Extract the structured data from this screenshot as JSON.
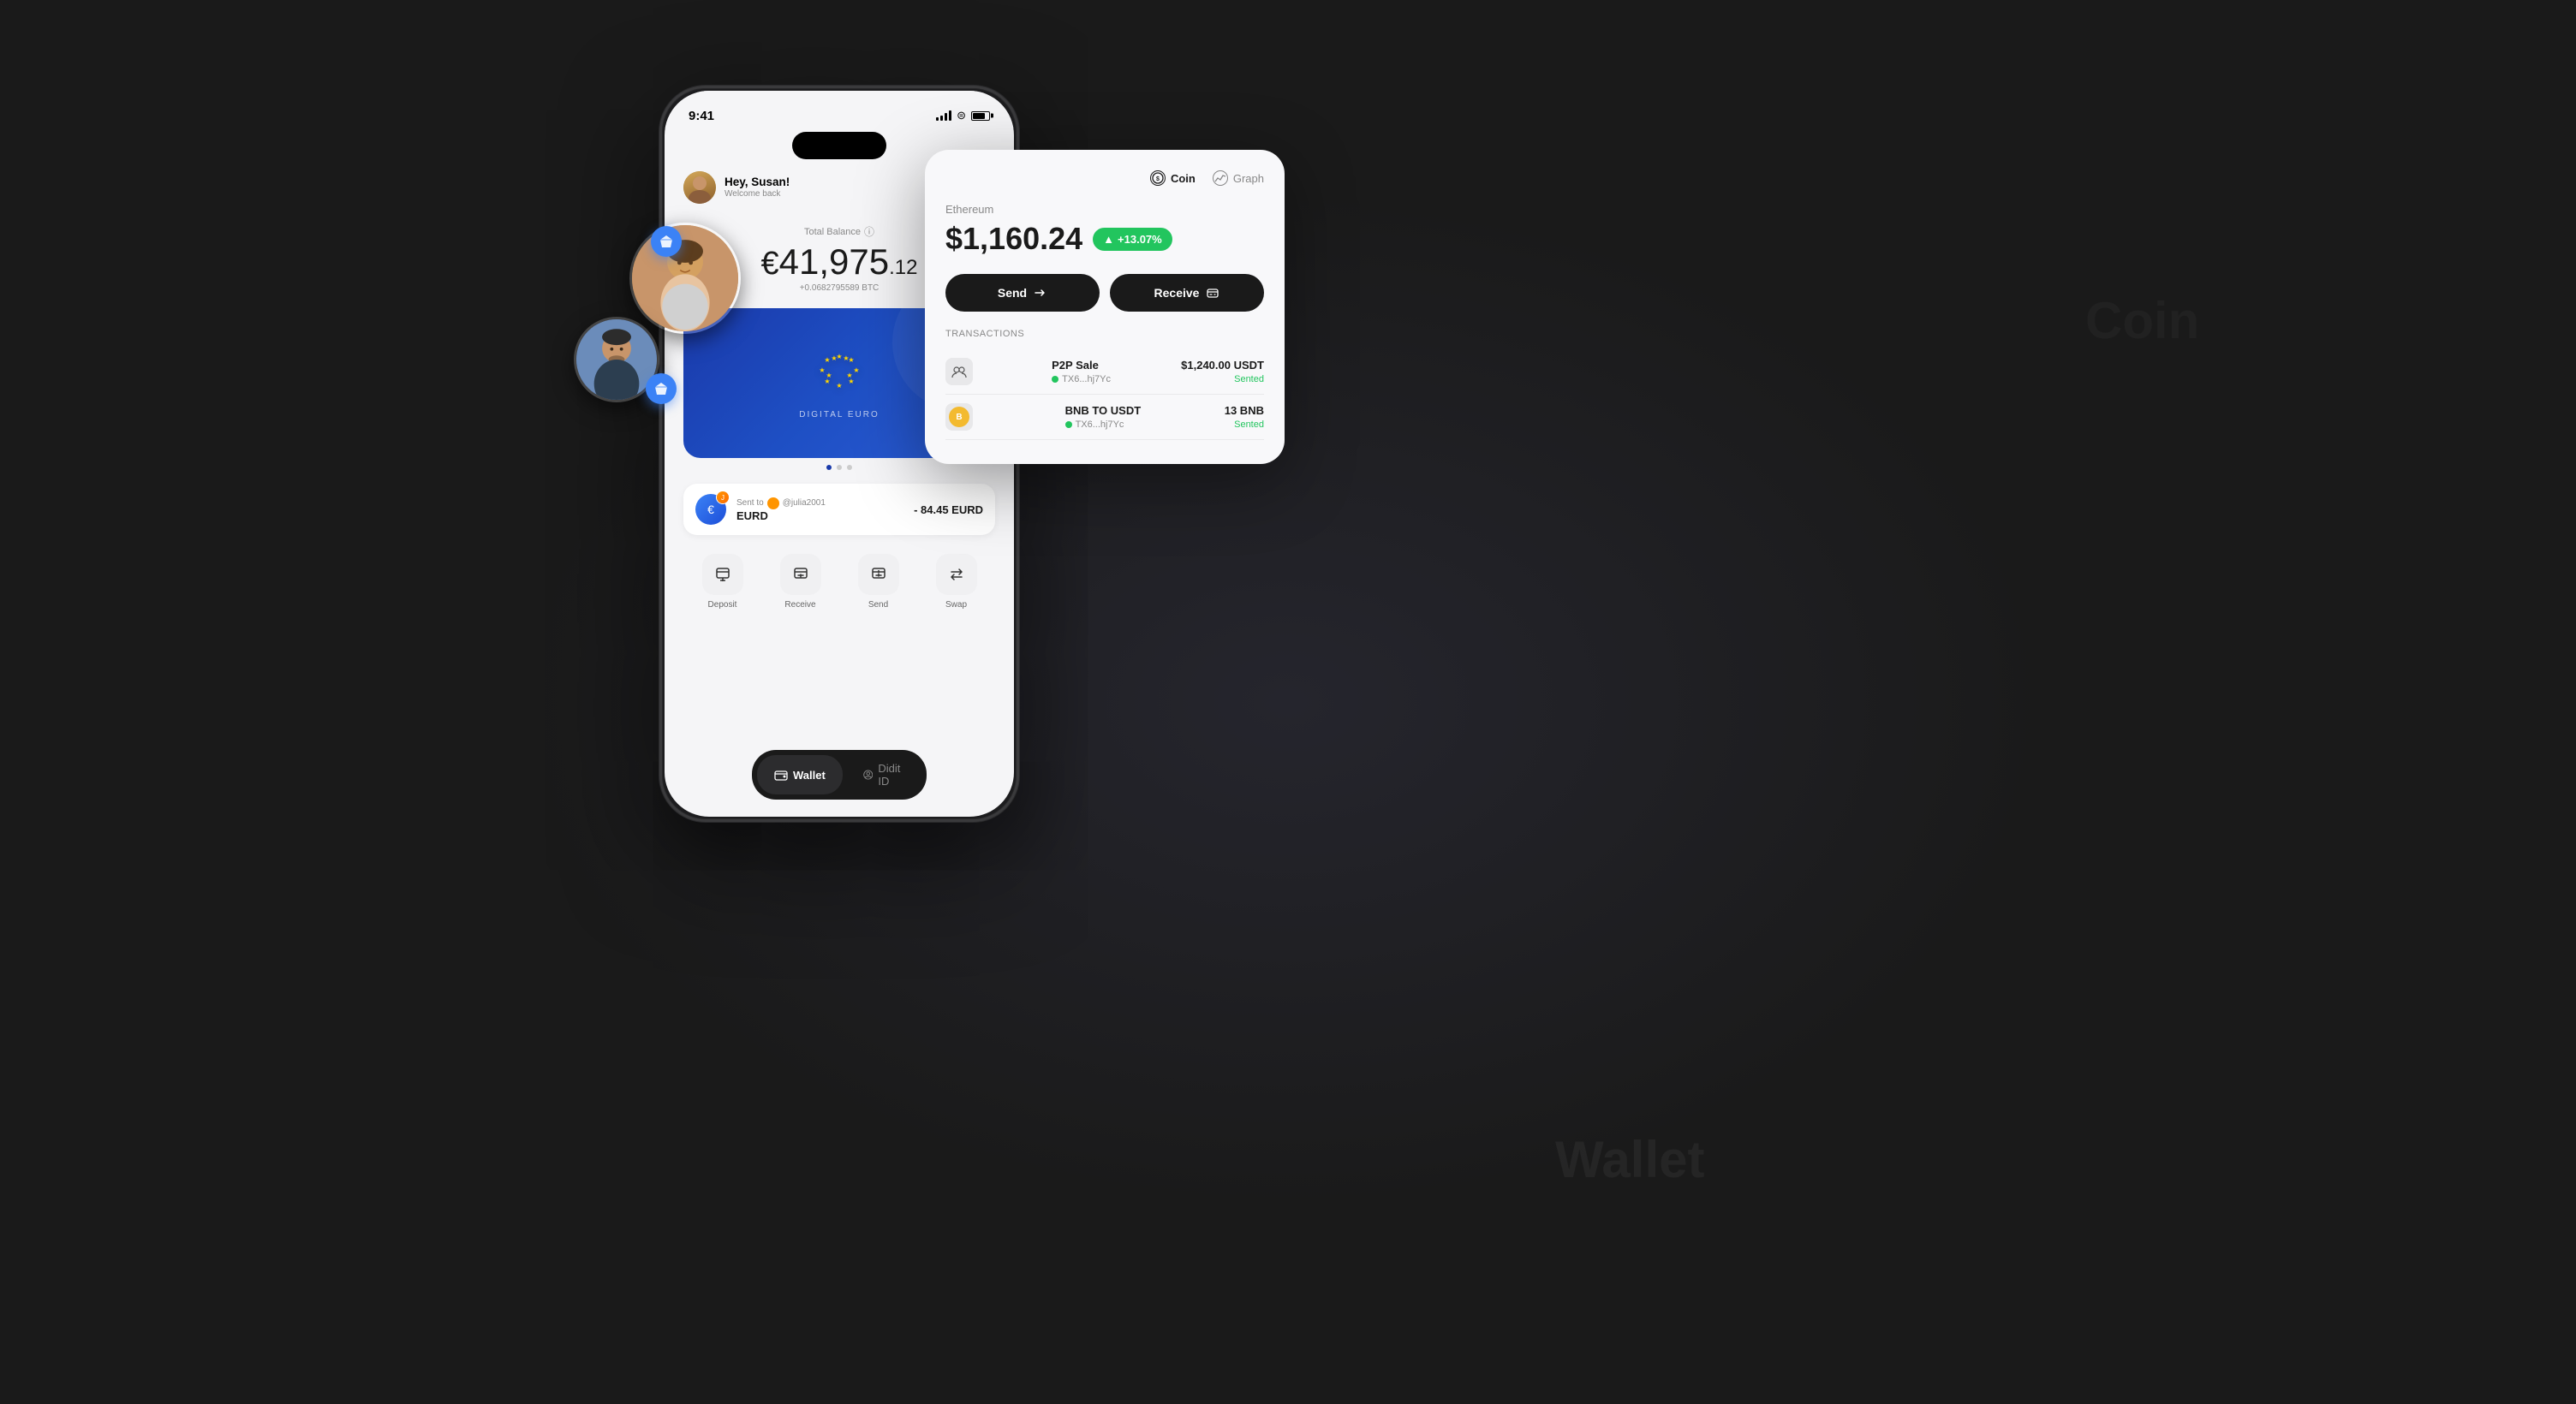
{
  "app": {
    "background_color": "#1a1a1a"
  },
  "status_bar": {
    "time": "9:41",
    "signal": "signal",
    "wifi": "wifi",
    "battery": "battery"
  },
  "header": {
    "greeting": "Hey, Susan!",
    "subtitle": "Welcome back",
    "scan_icon": "scan-icon",
    "settings_icon": "settings-icon"
  },
  "balance": {
    "label": "Total Balance",
    "currency_symbol": "€",
    "whole": "41,975",
    "decimals": ".12",
    "btc_value": "+0.0682795589 BTC"
  },
  "card": {
    "type": "DIGITAL EURO",
    "stars": "✦ ✦ ✦",
    "eu_flag_stars": "★ ★ ★ ★ ★★ ★ ★ ★ ★ ★★",
    "expand_icon": "expand-icon"
  },
  "transaction": {
    "sent_to_label": "Sent to",
    "recipient": "@julia2001",
    "currency": "EURD",
    "amount": "- 84.45 EURD"
  },
  "actions": [
    {
      "id": "deposit",
      "label": "Deposit",
      "icon": "deposit-icon"
    },
    {
      "id": "receive",
      "label": "Receive",
      "icon": "receive-icon"
    },
    {
      "id": "send",
      "label": "Send",
      "icon": "send-icon"
    },
    {
      "id": "swap",
      "label": "Swap",
      "icon": "swap-icon"
    }
  ],
  "bottom_nav": [
    {
      "id": "wallet",
      "label": "Wallet",
      "active": true,
      "icon": "wallet-nav-icon"
    },
    {
      "id": "didit_id",
      "label": "Didit ID",
      "active": false,
      "icon": "id-nav-icon"
    }
  ],
  "crypto_panel": {
    "tabs": [
      {
        "id": "coin",
        "label": "Coin",
        "icon": "coin-icon",
        "active": true
      },
      {
        "id": "graph",
        "label": "Graph",
        "icon": "graph-icon",
        "active": false
      }
    ],
    "coin_name": "Ethereum",
    "price": "$1,160.24",
    "change": "+13.07%",
    "send_label": "Send",
    "receive_label": "Receive",
    "transactions_label": "TRANSACTIONS",
    "transactions": [
      {
        "title": "P2P Sale",
        "hash": "TX6...hj7Yc",
        "amount": "$1,240.00 USDT",
        "status": "Sented",
        "icon": "p2p-icon"
      },
      {
        "title": "BNB TO USDT",
        "hash": "TX6...hj7Yc",
        "amount": "13 BNB",
        "status": "Sented",
        "icon": "bnb-icon"
      }
    ]
  },
  "floating_avatars": [
    {
      "id": "avatar-woman",
      "badge_icon": "💎"
    },
    {
      "id": "avatar-man",
      "badge_icon": "💎"
    }
  ],
  "hidden_texts": {
    "wallet": "Wallet",
    "coin": "Coin"
  }
}
